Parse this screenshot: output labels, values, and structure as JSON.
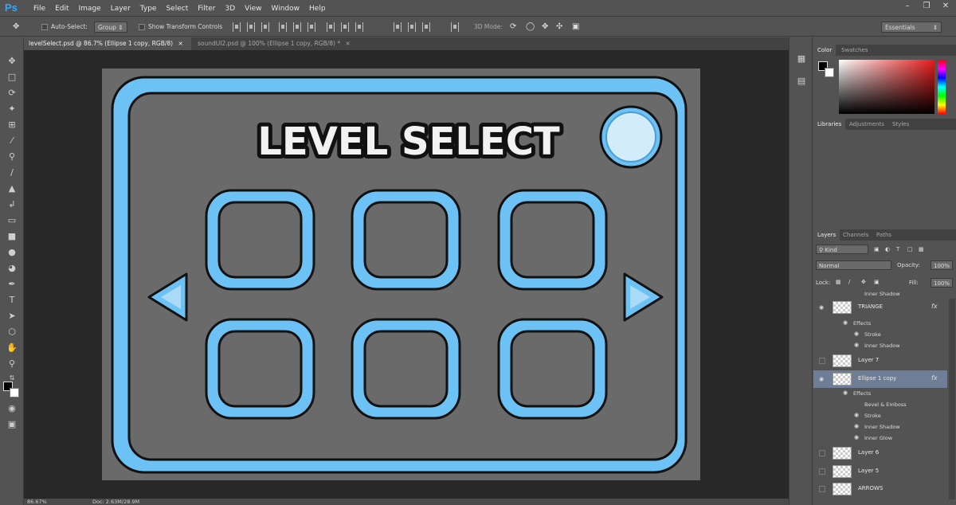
{
  "app": {
    "logo": "Ps"
  },
  "menu": {
    "items": [
      "File",
      "Edit",
      "Image",
      "Layer",
      "Type",
      "Select",
      "Filter",
      "3D",
      "View",
      "Window",
      "Help"
    ]
  },
  "options_bar": {
    "auto_select_label": "Auto-Select:",
    "auto_select_value": "Group",
    "show_transform_label": "Show Transform Controls",
    "three_d_mode_label": "3D Mode:",
    "workspace_value": "Essentials"
  },
  "tabs": [
    {
      "label": "levelSelect.psd @ 86.7% (Ellipse 1 copy, RGB/8)",
      "close": "×"
    },
    {
      "label": "soundUI2.psd @ 100% (Ellipse 1 copy, RGB/8) *",
      "close": "×"
    }
  ],
  "canvas": {
    "title_text": "LEVEL SELECT",
    "colors": {
      "frame": "#6cc1f5",
      "panel": "#6a6a6a",
      "outline": "#111111",
      "button_fill": "#d2ecfa"
    }
  },
  "status": {
    "zoom": "86.67%",
    "doc": "Doc: 2.63M/28.9M"
  },
  "panels": {
    "color_tabs": [
      "Color",
      "Swatches"
    ],
    "library_tabs": [
      "Libraries",
      "Adjustments",
      "Styles"
    ],
    "layers_tabs": [
      "Layers",
      "Channels",
      "Paths"
    ],
    "kind_label": "Kind",
    "blend_mode": "Normal",
    "opacity_label": "Opacity:",
    "opacity_value": "100%",
    "lock_label": "Lock:",
    "fill_label": "Fill:",
    "fill_value": "100%"
  },
  "layers": {
    "top_effect": "Inner Shadow",
    "rows": [
      {
        "name": "TRIANGE",
        "fx": "fx",
        "effects_label": "Effects",
        "effects": [
          "Stroke",
          "Inner Shadow"
        ]
      },
      {
        "name": "Layer 7"
      },
      {
        "name": "Ellipse 1 copy",
        "fx": "fx",
        "effects_label": "Effects",
        "effects": [
          "Bevel & Emboss",
          "Stroke",
          "Inner Shadow",
          "Inner Glow"
        ]
      },
      {
        "name": "Layer 6"
      },
      {
        "name": "Layer 5"
      },
      {
        "name": "ARROWS"
      }
    ]
  }
}
